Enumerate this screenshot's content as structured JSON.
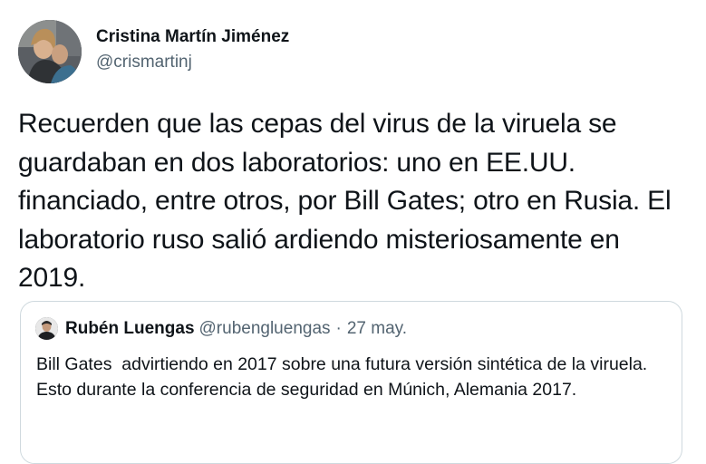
{
  "author": {
    "display_name": "Cristina Martín Jiménez",
    "handle": "@crismartinj",
    "avatar_icon": "user-photo-avatar"
  },
  "tweet": {
    "text": "Recuerden que las cepas del virus de la viruela se guardaban en dos laboratorios: uno en EE.UU. financiado, entre otros, por Bill Gates; otro en Rusia. El laboratorio ruso salió ardiendo misteriosamente en 2019."
  },
  "quoted_tweet": {
    "display_name": "Rubén Luengas",
    "handle": "@rubengluengas",
    "separator": "·",
    "date": "27 may.",
    "avatar_icon": "user-photo-avatar",
    "lines": [
      "Bill Gates  advirtiendo en 2017 sobre una futura versión sintética de la viruela.",
      "Esto durante la conferencia de seguridad en Múnich, Alemania 2017."
    ]
  },
  "colors": {
    "text_primary": "#0f1419",
    "text_secondary": "#536471",
    "border": "#cfd9de"
  }
}
